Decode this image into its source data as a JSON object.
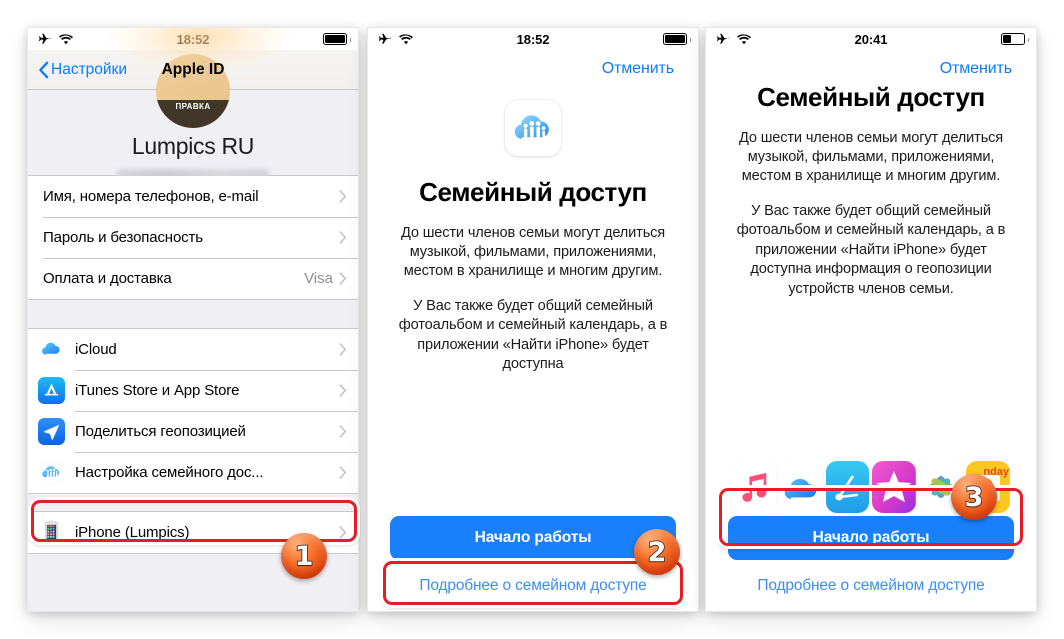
{
  "panels": [
    {
      "id": "apple-id-settings",
      "statusbar": {
        "time": "18:52",
        "airplane": "airplane-mode-icon",
        "wifi": "wifi-icon",
        "battery_pct": 100
      },
      "navbar": {
        "back_label": "Настройки",
        "title": "Apple ID"
      },
      "profile": {
        "edit_label": "ПРАВКА",
        "name": "Lumpics RU",
        "email_redacted": true
      },
      "group_account": [
        {
          "label": "Имя, номера телефонов, e-mail",
          "value": ""
        },
        {
          "label": "Пароль и безопасность",
          "value": ""
        },
        {
          "label": "Оплата и доставка",
          "value": "Visa"
        }
      ],
      "group_services": [
        {
          "label": "iCloud",
          "icon": "icloud-icon"
        },
        {
          "label": "iTunes Store и App Store",
          "icon": "app-store-icon"
        },
        {
          "label": "Поделиться геопозицией",
          "icon": "find-my-icon"
        },
        {
          "label": "Настройка семейного дос...",
          "icon": "family-sharing-icon",
          "highlighted": true
        }
      ],
      "group_devices": [
        {
          "label": "iPhone (Lumpics)",
          "icon": "iphone-device-icon"
        }
      ]
    },
    {
      "id": "family-sharing-intro-scrolled-top",
      "statusbar": {
        "time": "18:52",
        "airplane": "airplane-mode-icon",
        "wifi": "wifi-icon",
        "battery_pct": 100
      },
      "cancel_label": "Отменить",
      "hero_icon": "family-sharing-cloud-icon",
      "title": "Семейный доступ",
      "paragraphs": [
        "До шести членов семьи могут делиться музыкой, фильмами, приложениями, местом в хранилище и многим другим.",
        "У Вас также будет общий семейный фотоальбом и семейный календарь, а в приложении «Найти iPhone» будет доступна"
      ],
      "cta_label": "Начало работы",
      "cta_sub_label": "Подробнее о семейном доступе",
      "highlight_target": "cta_sub_label"
    },
    {
      "id": "family-sharing-intro-scrolled-bottom",
      "statusbar": {
        "time": "20:41",
        "airplane": "airplane-mode-icon",
        "wifi": "wifi-icon",
        "battery_pct": 40
      },
      "cancel_label": "Отменить",
      "title": "Семейный доступ",
      "paragraphs": [
        "До шести членов семьи могут делиться музыкой, фильмами, приложениями, местом в хранилище и многим другим.",
        "У Вас также будет общий семейный фотоальбом и семейный календарь, а в приложении «Найти iPhone» будет доступна информация о геопозиции устройств членов семьи."
      ],
      "app_strip": [
        "music-app-icon",
        "icloud-drive-app-icon",
        "find-my-iphone-app-icon",
        "itunes-store-app-icon",
        "photos-app-icon",
        "calendar-app-icon"
      ],
      "calendar_text": "nday",
      "cta_label": "Начало работы",
      "cta_sub_label": "Подробнее о семейном доступе",
      "highlight_target": "cta_label"
    }
  ],
  "annotations": [
    {
      "number": "1",
      "target": "family-sharing-settings-row"
    },
    {
      "number": "2",
      "target": "learn-more-link-panel2"
    },
    {
      "number": "3",
      "target": "get-started-button-panel3"
    }
  ],
  "colors": {
    "accent_blue": "#0a7cff",
    "cta_blue": "#1a7ffb",
    "annotation_red": "#e81c24",
    "badge_orange": "#f8712a",
    "list_bg": "#efeff4"
  }
}
